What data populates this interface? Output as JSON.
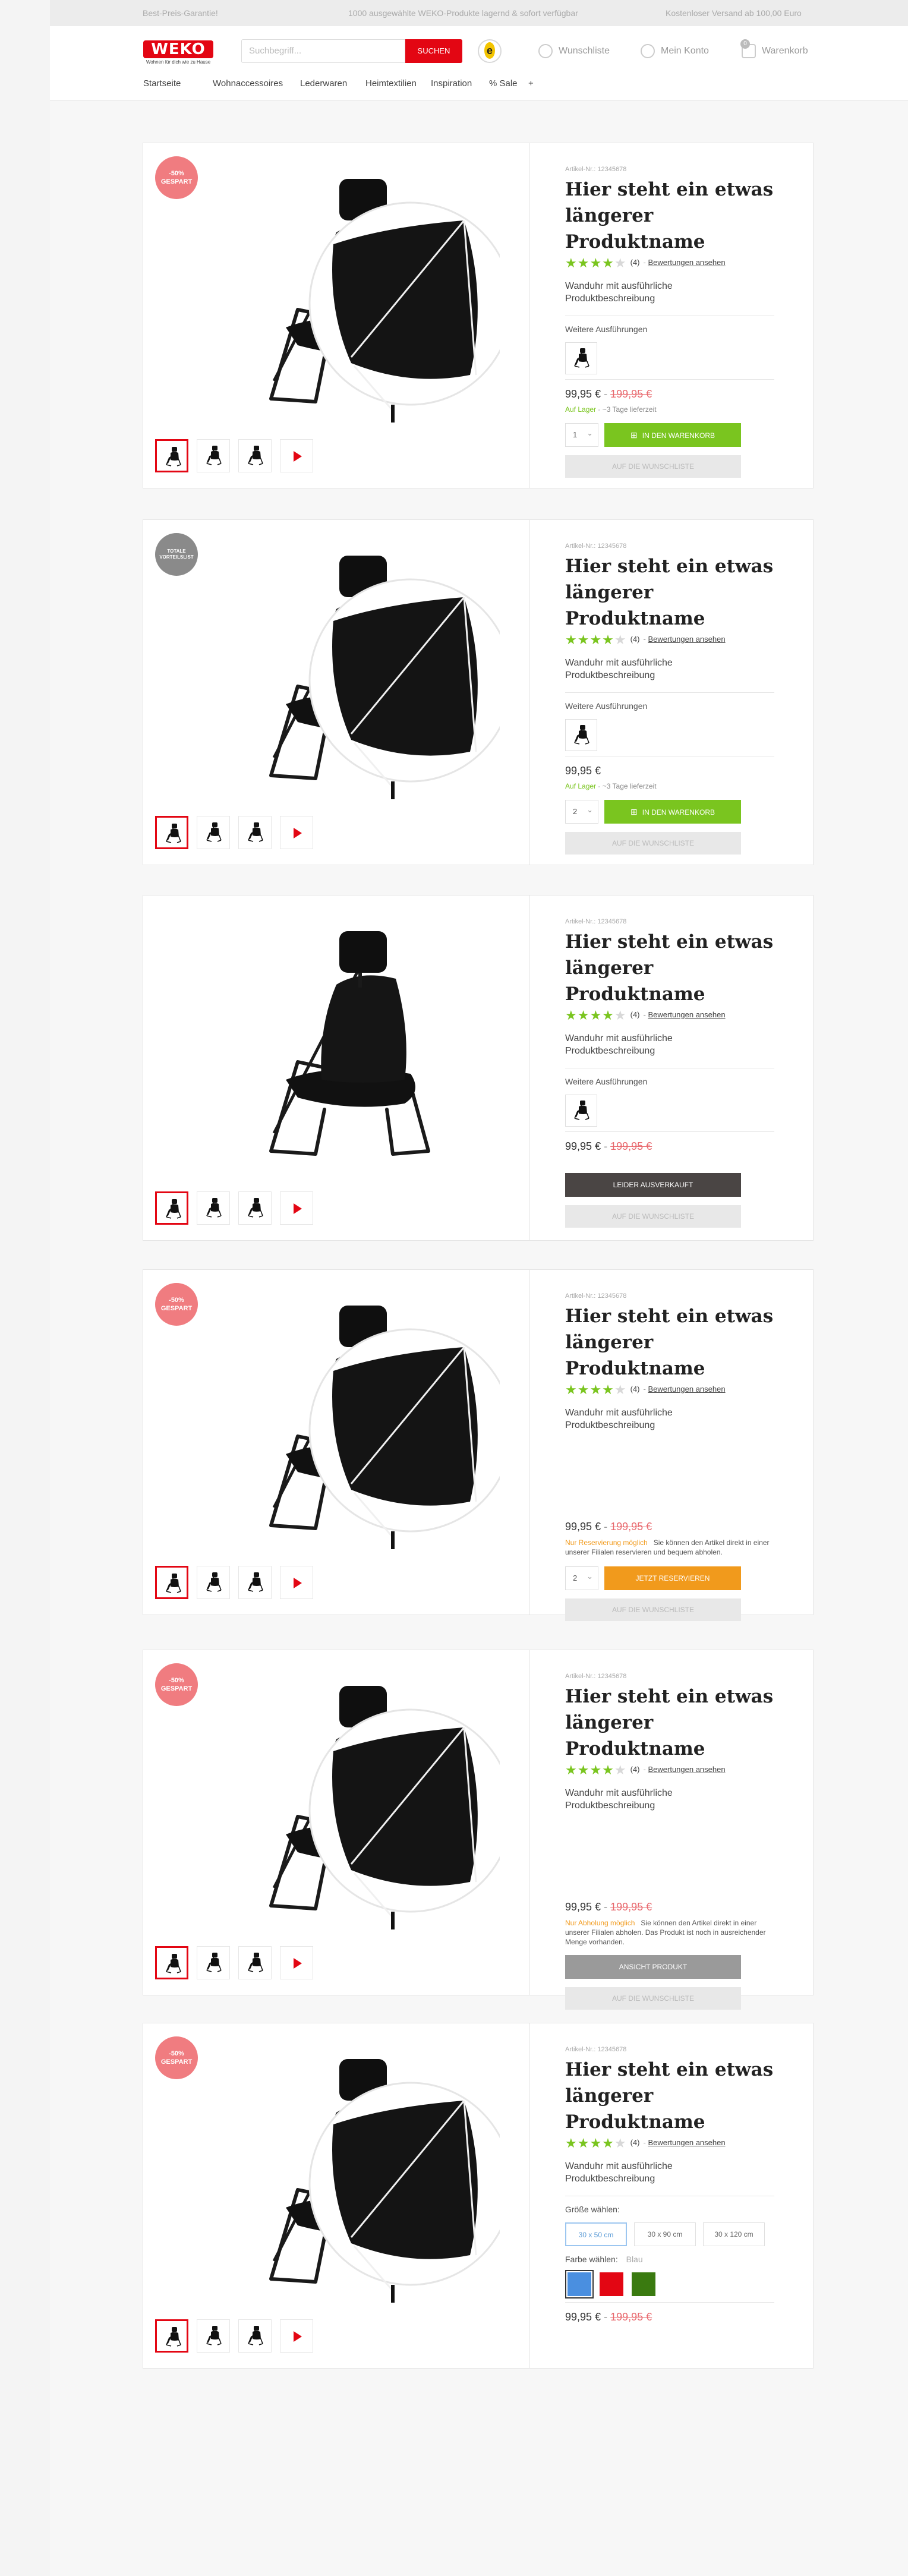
{
  "topbar": {
    "left": "Best-Preis-Garantie!",
    "center": "1000 ausgewählte WEKO-Produkte lagernd & sofort verfügbar",
    "right": "Kostenloser Versand ab 100,00 Euro"
  },
  "header": {
    "logo_text": "WEKO",
    "logo_tagline": "Wohnen für dich wie zu Hause",
    "search_placeholder": "Suchbegriff...",
    "search_button": "SUCHEN",
    "wishlist": "Wunschliste",
    "account": "Mein Konto",
    "cart": "Warenkorb",
    "cart_count": "0"
  },
  "nav": {
    "items": [
      "Startseite",
      "Wohnaccessoires",
      "Lederwaren",
      "Heimtextilien",
      "Inspiration",
      "% Sale",
      "+"
    ]
  },
  "colors": {
    "brand_red": "#e30613",
    "green": "#7ac51f",
    "orange": "#f19a1c",
    "dark": "#4a4544",
    "gray_button": "#9a9a9a"
  },
  "products": [
    {
      "badge": "-50%\nGESPART",
      "artno": "Artikel-Nr.: 12345678",
      "title": "Hier steht ein etwas längerer Produktname",
      "stars": 4,
      "rating_count": "(4)",
      "reviews_link": "Bewertungen ansehen",
      "desc": "Wanduhr mit ausführliche Produktbeschreibung",
      "more_label": "Weitere Ausführungen",
      "price": "99,95",
      "currency": "€",
      "old_price": "199,95 €",
      "stock_status": "Auf Lager",
      "delivery": "~3 Tage lieferzeit",
      "qty": "1",
      "cart_button": "IN DEN WARENKORB",
      "wishlist_button": "AUF DIE WUNSCHLISTE"
    },
    {
      "badge": "TOTALE\nVORTEILSLIST",
      "artno": "Artikel-Nr.: 12345678",
      "title": "Hier steht ein etwas längerer Produktname",
      "stars": 4,
      "rating_count": "(4)",
      "reviews_link": "Bewertungen ansehen",
      "desc": "Wanduhr mit ausführliche Produktbeschreibung",
      "more_label": "Weitere Ausführungen",
      "price": "99,95",
      "currency": "€",
      "stock_status": "Auf Lager",
      "delivery": "~3 Tage lieferzeit",
      "qty": "2",
      "cart_button": "IN DEN WARENKORB",
      "wishlist_button": "AUF DIE WUNSCHLISTE"
    },
    {
      "artno": "Artikel-Nr.: 12345678",
      "title": "Hier steht ein etwas längerer Produktname",
      "stars": 4,
      "rating_count": "(4)",
      "reviews_link": "Bewertungen ansehen",
      "desc": "Wanduhr mit ausführliche Produktbeschreibung",
      "more_label": "Weitere Ausführungen",
      "price": "99,95",
      "currency": "€",
      "old_price": "199,95 €",
      "soldout_button": "LEIDER AUSVERKAUFT",
      "wishlist_button": "AUF DIE WUNSCHLISTE"
    },
    {
      "badge": "-50%\nGESPART",
      "artno": "Artikel-Nr.: 12345678",
      "title": "Hier steht ein etwas längerer Produktname",
      "stars": 4,
      "rating_count": "(4)",
      "reviews_link": "Bewertungen ansehen",
      "desc": "Wanduhr mit ausführliche Produktbeschreibung",
      "price": "99,95",
      "currency": "€",
      "old_price": "199,95 €",
      "note_status": "Nur Reservierung möglich",
      "note_text": "Sie können den Artikel direkt in einer unserer Filialen reservieren und bequem abholen.",
      "qty": "2",
      "reserve_button": "JETZT RESERVIEREN",
      "wishlist_button": "AUF DIE WUNSCHLISTE"
    },
    {
      "badge": "-50%\nGESPART",
      "artno": "Artikel-Nr.: 12345678",
      "title": "Hier steht ein etwas längerer Produktname",
      "stars": 4,
      "rating_count": "(4)",
      "reviews_link": "Bewertungen ansehen",
      "desc": "Wanduhr mit ausführliche Produktbeschreibung",
      "price": "99,95",
      "currency": "€",
      "old_price": "199,95 €",
      "note_status": "Nur Abholung möglich",
      "note_text": "Sie können den Artikel direkt in einer unserer Filialen abholen. Das Produkt ist noch in ausreichender Menge vorhanden.",
      "view_button": "ANSICHT PRODUKT",
      "wishlist_button": "AUF DIE WUNSCHLISTE"
    },
    {
      "badge": "-50%\nGESPART",
      "artno": "Artikel-Nr.: 12345678",
      "title": "Hier steht ein etwas längerer Produktname",
      "stars": 4,
      "rating_count": "(4)",
      "reviews_link": "Bewertungen ansehen",
      "desc": "Wanduhr mit ausführliche Produktbeschreibung",
      "size_label": "Größe wählen:",
      "sizes": [
        "30 x 50 cm",
        "30 x 90 cm",
        "30 x 120 cm"
      ],
      "color_label": "Farbe wählen:",
      "color_value": "Blau",
      "swatches": [
        "#4a8fe0",
        "#e30613",
        "#3a7a10"
      ],
      "price": "99,95",
      "currency": "€",
      "old_price": "199,95 €"
    }
  ]
}
